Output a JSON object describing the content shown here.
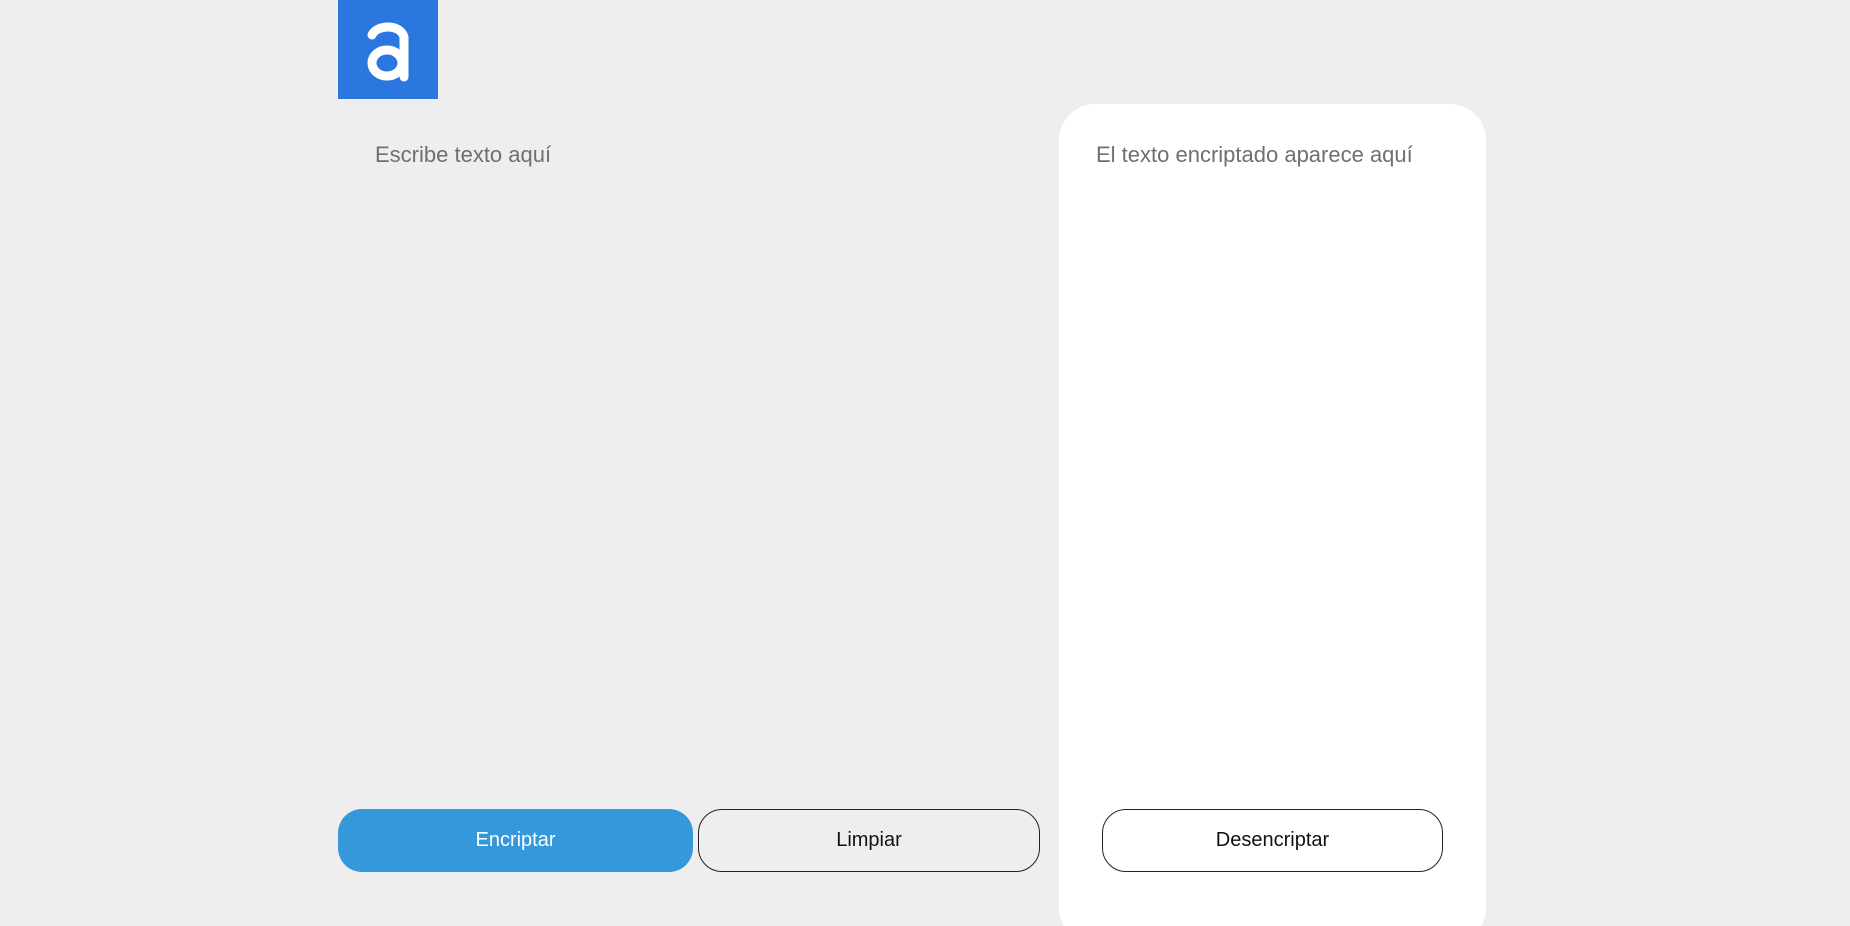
{
  "logo": {
    "letter": "a",
    "icon": "letter-a-logo",
    "color": "#2a77e0"
  },
  "input": {
    "placeholder": "Escribe texto aquí",
    "value": ""
  },
  "output": {
    "placeholder": "El texto encriptado aparece aquí",
    "value": ""
  },
  "buttons": {
    "encrypt_label": "Encriptar",
    "clear_label": "Limpiar",
    "decrypt_label": "Desencriptar"
  },
  "colors": {
    "background": "#eeeeee",
    "accent": "#3498db",
    "panel": "#ffffff"
  }
}
